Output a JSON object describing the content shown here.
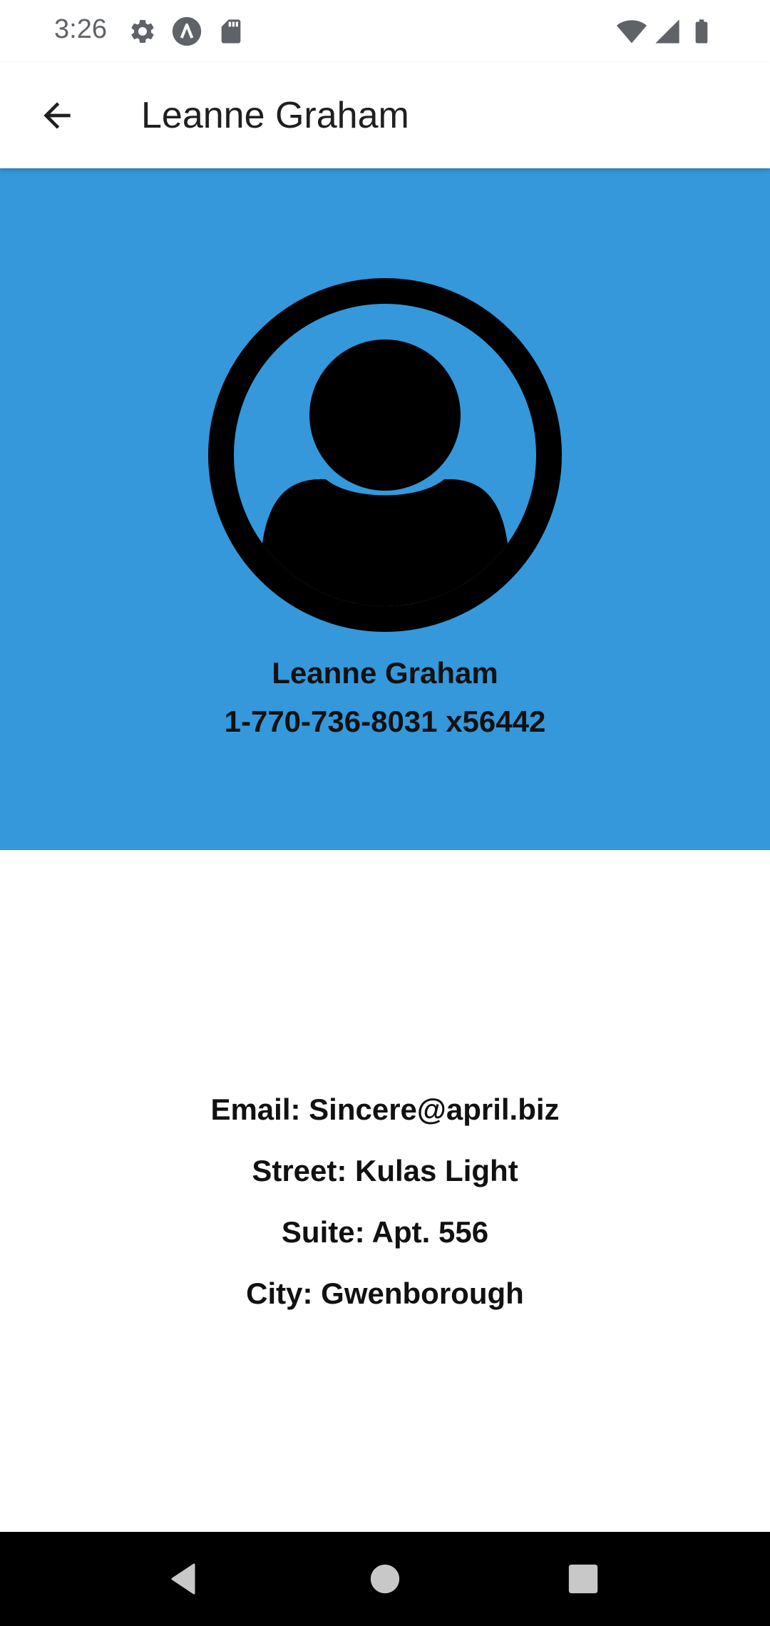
{
  "status_bar": {
    "time": "3:26",
    "left_icons": [
      "settings-icon",
      "app-notification-icon",
      "sd-card-icon"
    ],
    "right_icons": [
      "wifi-icon",
      "cellular-signal-icon",
      "battery-icon"
    ]
  },
  "app_bar": {
    "title": "Leanne Graham",
    "back_icon": "arrow-back-icon"
  },
  "profile": {
    "avatar_icon": "account-circle-icon",
    "name": "Leanne Graham",
    "phone": "1-770-736-8031 x56442",
    "header_color": "#3498db"
  },
  "details": {
    "email": "Email: Sincere@april.biz",
    "street": "Street: Kulas Light",
    "suite": "Suite: Apt. 556",
    "city": "City: Gwenborough"
  },
  "nav_bar": {
    "back": "nav-back-icon",
    "home": "nav-home-icon",
    "recents": "nav-recents-icon"
  }
}
